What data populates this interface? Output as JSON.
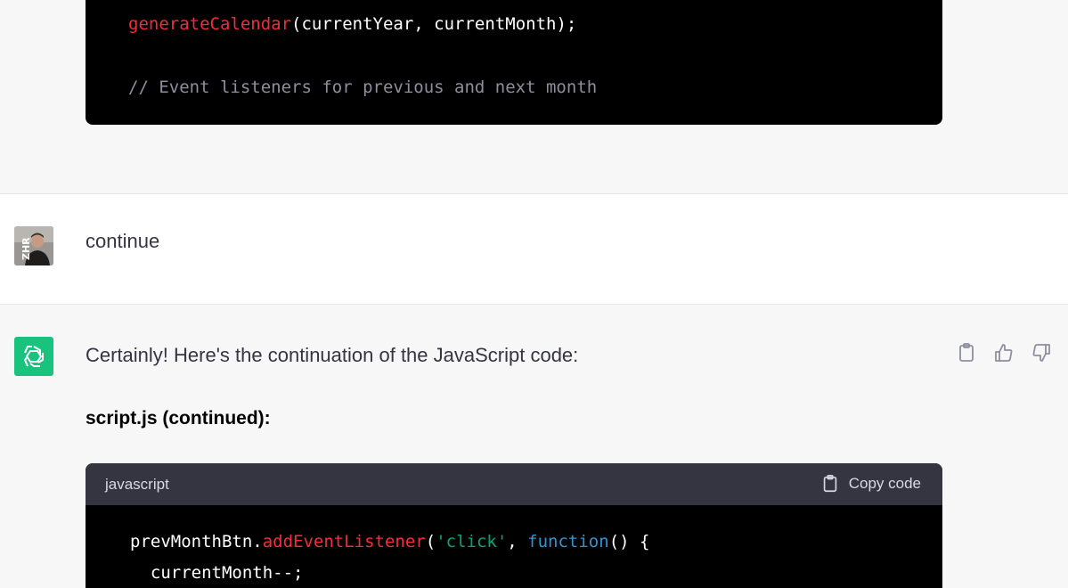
{
  "top_code": {
    "line1": {
      "fn": "generateCalendar",
      "rest": "(currentYear, currentMonth);"
    },
    "line2": {
      "comment": "// Event listeners for previous and next month"
    }
  },
  "user_message": {
    "avatar_label": "ZHR",
    "text": "continue"
  },
  "assistant_message": {
    "text": "Certainly! Here's the continuation of the JavaScript code:",
    "subheading": "script.js (continued):",
    "actions": [
      "clipboard-icon",
      "thumbs-up-icon",
      "thumbs-down-icon"
    ]
  },
  "code_block": {
    "language": "javascript",
    "copy_label": "Copy code",
    "line1": {
      "obj": "prevMonthBtn.",
      "method": "addEventListener",
      "open": "(",
      "string": "'click'",
      "comma": ", ",
      "keyword": "function",
      "tail": "() {"
    },
    "line2": {
      "text": "  currentMonth--;"
    }
  },
  "colors": {
    "accent_green": "#19c37d",
    "code_bg": "#000000",
    "code_header_bg": "#343541",
    "token_red": "#f22c3d",
    "token_green": "#00a67d",
    "token_blue": "#2e95d3"
  }
}
